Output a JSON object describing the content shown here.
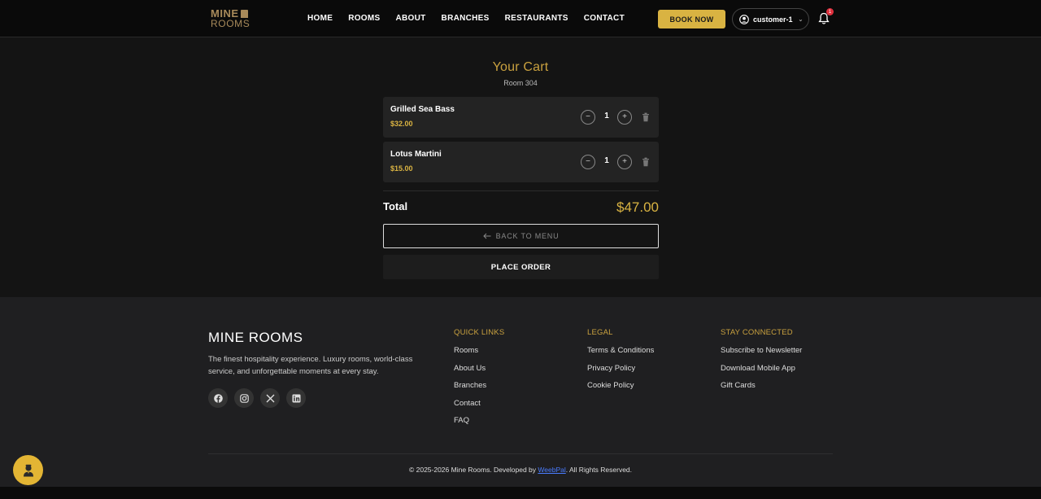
{
  "brand": {
    "logo_line1": "MINE",
    "logo_line2": "ROOMS"
  },
  "nav": {
    "items": [
      "HOME",
      "ROOMS",
      "ABOUT",
      "BRANCHES",
      "RESTAURANTS",
      "CONTACT"
    ]
  },
  "header": {
    "book_label": "BOOK NOW",
    "user_label": "customer-1",
    "notification_count": "1"
  },
  "cart": {
    "title": "Your Cart",
    "room": "Room 304",
    "items": [
      {
        "name": "Grilled Sea Bass",
        "price": "$32.00",
        "qty": "1"
      },
      {
        "name": "Lotus Martini",
        "price": "$15.00",
        "qty": "1"
      }
    ],
    "total_label": "Total",
    "total_value": "$47.00",
    "back_label": "BACK TO MENU",
    "place_label": "PLACE ORDER"
  },
  "footer": {
    "brand": "MINE ROOMS",
    "description": "The finest hospitality experience. Luxury rooms, world-class service, and unforgettable moments at every stay.",
    "columns": [
      {
        "title": "QUICK LINKS",
        "links": [
          "Rooms",
          "About Us",
          "Branches",
          "Contact",
          "FAQ"
        ]
      },
      {
        "title": "LEGAL",
        "links": [
          "Terms & Conditions",
          "Privacy Policy",
          "Cookie Policy"
        ]
      },
      {
        "title": "STAY CONNECTED",
        "links": [
          "Subscribe to Newsletter",
          "Download Mobile App",
          "Gift Cards"
        ]
      }
    ],
    "social_icons": [
      "facebook-icon",
      "instagram-icon",
      "x-icon",
      "linkedin-icon"
    ],
    "copyright_prefix": "© 2025-2026 Mine Rooms. Developed by ",
    "developer": "WeebPal",
    "copyright_suffix": ". All Rights Reserved."
  },
  "colors": {
    "accent": "#d9b342",
    "background": "#141414",
    "footer": "#1f1f21",
    "badge": "#e0313e"
  }
}
